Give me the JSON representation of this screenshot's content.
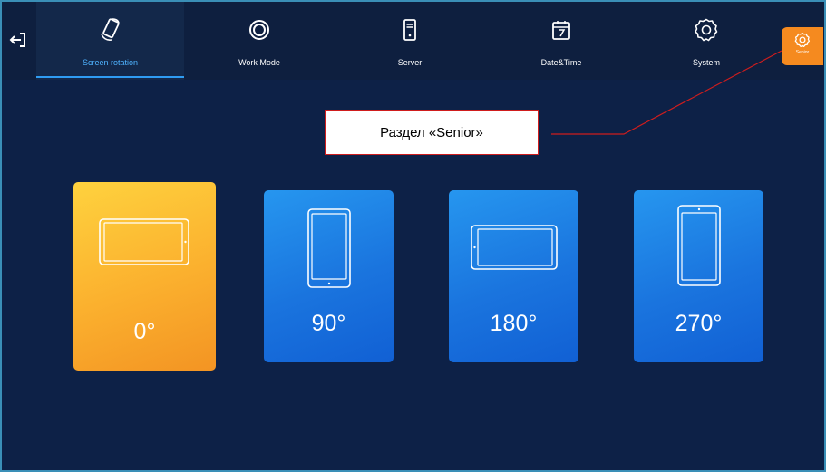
{
  "header": {
    "back_icon": "exit-arrow-icon",
    "tabs": [
      {
        "label": "Screen rotation",
        "icon": "phone-rotate-icon",
        "active": true
      },
      {
        "label": "Work Mode",
        "icon": "ring-icon",
        "active": false
      },
      {
        "label": "Server",
        "icon": "server-icon",
        "active": false
      },
      {
        "label": "Date&Time",
        "icon": "calendar-icon",
        "active": false
      },
      {
        "label": "System",
        "icon": "gear-icon",
        "active": false
      }
    ],
    "senior": {
      "label": "Senior",
      "icon": "gear-small-icon",
      "color": "#f58a1f"
    }
  },
  "annotation": {
    "text": "Раздел «Senior»",
    "color": "#d01d1d"
  },
  "rotations": [
    {
      "label": "0°",
      "selected": true
    },
    {
      "label": "90°",
      "selected": false
    },
    {
      "label": "180°",
      "selected": false
    },
    {
      "label": "270°",
      "selected": false
    }
  ],
  "colors": {
    "background": "#0d2147",
    "selected_card": "#f7a126",
    "card": "#1976e0",
    "active_tab": "#2f9cf2"
  }
}
